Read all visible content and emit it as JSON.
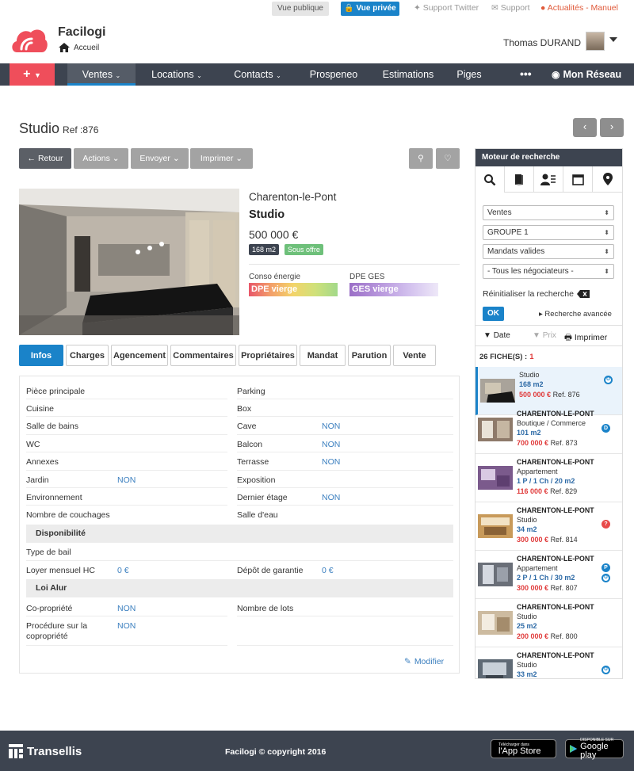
{
  "topbar": {
    "vue_publique": "Vue publique",
    "vue_privee": "Vue privée",
    "support_twitter": "Support Twitter",
    "support": "Support",
    "actualites": "Actualités - Manuel"
  },
  "header": {
    "brand": "Facilogi",
    "breadcrumb": "Accueil",
    "user_name": "Thomas DURAND"
  },
  "nav": {
    "items": [
      "Ventes",
      "Locations",
      "Contacts",
      "Prospeneo",
      "Estimations",
      "Piges"
    ],
    "more": "•••",
    "network": "Mon Réseau"
  },
  "page": {
    "title": "Studio",
    "ref": "Ref :876"
  },
  "toolbar": {
    "retour": "Retour",
    "actions": "Actions",
    "envoyer": "Envoyer",
    "imprimer": "Imprimer"
  },
  "listing": {
    "city": "Charenton-le-Pont",
    "type": "Studio",
    "price": "500 000 €",
    "surface_badge": "168 m2",
    "status_badge": "Sous offre",
    "conso_label": "Conso énergie",
    "dpe_ges_label": "DPE GES",
    "dpe_value": "DPE vierge",
    "ges_value": "GES vierge"
  },
  "tabs": [
    "Infos",
    "Charges",
    "Agencement",
    "Commentaires",
    "Propriétaires",
    "Mandat",
    "Parution",
    "Vente"
  ],
  "info": {
    "left": [
      {
        "label": "Pièce principale",
        "value": ""
      },
      {
        "label": "Cuisine",
        "value": ""
      },
      {
        "label": "Salle de bains",
        "value": ""
      },
      {
        "label": "WC",
        "value": ""
      },
      {
        "label": "Annexes",
        "value": ""
      },
      {
        "label": "Jardin",
        "value": "NON"
      },
      {
        "label": "Environnement",
        "value": ""
      },
      {
        "label": "Nombre de couchages",
        "value": ""
      }
    ],
    "right": [
      {
        "label": "Parking",
        "value": ""
      },
      {
        "label": "Box",
        "value": ""
      },
      {
        "label": "Cave",
        "value": "NON"
      },
      {
        "label": "Balcon",
        "value": "NON"
      },
      {
        "label": "Terrasse",
        "value": "NON"
      },
      {
        "label": "Exposition",
        "value": ""
      },
      {
        "label": "Dernier étage",
        "value": "NON"
      },
      {
        "label": "Salle d'eau",
        "value": ""
      }
    ],
    "section_disponibilite": "Disponibilité",
    "type_bail": "Type de bail",
    "loyer_label": "Loyer mensuel HC",
    "loyer_value": "0 €",
    "depot_label": "Dépôt de garantie",
    "depot_value": "0 €",
    "section_alur": "Loi Alur",
    "copro_label": "Co-propriété",
    "copro_value": "NON",
    "lots_label": "Nombre de lots",
    "procedure_label": "Procédure sur la copropriété",
    "procedure_value": "NON",
    "modifier": "Modifier"
  },
  "sidebar": {
    "title": "Moteur de recherche",
    "selects": [
      "Ventes",
      "GROUPE 1",
      "Mandats valides",
      "- Tous les négociateurs -"
    ],
    "reinit": "Réinitialiser la recherche",
    "ok": "OK",
    "advanced": "Recherche avancée",
    "sort_date": "Date",
    "sort_price": "Prix",
    "print": "Imprimer",
    "count_label": "26 FICHE(S) :",
    "count_page": "1",
    "cards": [
      {
        "city": "",
        "type": "Studio",
        "detail": "168 m2",
        "price": "500 000 €",
        "ref": "Ref. 876",
        "icons": [
          "O"
        ]
      },
      {
        "city": "CHARENTON-LE-PONT",
        "type": "Boutique / Commerce",
        "detail": "101 m2",
        "price": "700 000 €",
        "ref": "Ref. 873",
        "icons": [
          "D"
        ]
      },
      {
        "city": "CHARENTON-LE-PONT",
        "type": "Appartement",
        "detail": "1 P / 1 Ch / 20 m2",
        "price": "116 000 €",
        "ref": "Ref. 829",
        "icons": []
      },
      {
        "city": "CHARENTON-LE-PONT",
        "type": "Studio",
        "detail": "34 m2",
        "price": "300 000 €",
        "ref": "Ref. 814",
        "icons": [
          "?"
        ]
      },
      {
        "city": "CHARENTON-LE-PONT",
        "type": "Appartement",
        "detail": "2 P / 1 Ch / 30 m2",
        "price": "300 000 €",
        "ref": "Ref. 807",
        "icons": [
          "P",
          "O"
        ]
      },
      {
        "city": "CHARENTON-LE-PONT",
        "type": "Studio",
        "detail": "25 m2",
        "price": "200 000 €",
        "ref": "Ref. 800",
        "icons": []
      },
      {
        "city": "CHARENTON-LE-PONT",
        "type": "Studio",
        "detail": "33 m2",
        "price": "",
        "ref": "",
        "icons": [
          "O"
        ]
      }
    ]
  },
  "footer": {
    "company": "Transellis",
    "copyright": "Facilogi © copyright 2016",
    "appstore_small": "Télécharger dans",
    "appstore_large": "l'App Store",
    "google_small": "DISPONIBLE SUR",
    "google_large": "Google play"
  }
}
